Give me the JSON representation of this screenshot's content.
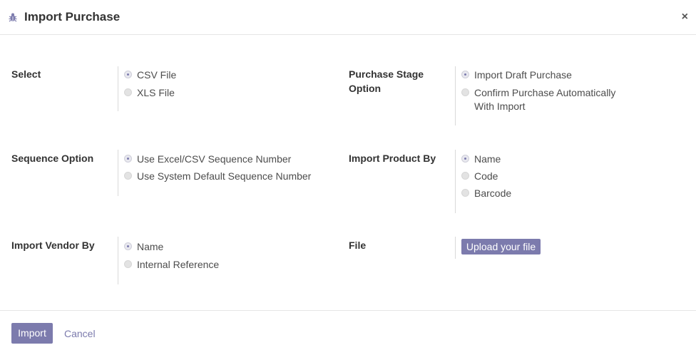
{
  "dialog": {
    "title": "Import Purchase",
    "close_label": "×"
  },
  "fields": {
    "select": {
      "label": "Select",
      "options": [
        {
          "label": "CSV File",
          "checked": true
        },
        {
          "label": "XLS File",
          "checked": false
        }
      ]
    },
    "purchase_stage": {
      "label": "Purchase Stage Option",
      "options": [
        {
          "label": "Import Draft Purchase",
          "checked": true
        },
        {
          "label": "Confirm Purchase Automatically With Import",
          "checked": false
        }
      ]
    },
    "sequence": {
      "label": "Sequence Option",
      "options": [
        {
          "label": "Use Excel/CSV Sequence Number",
          "checked": true
        },
        {
          "label": "Use System Default Sequence Number",
          "checked": false
        }
      ]
    },
    "product_by": {
      "label": "Import Product By",
      "options": [
        {
          "label": "Name",
          "checked": true
        },
        {
          "label": "Code",
          "checked": false
        },
        {
          "label": "Barcode",
          "checked": false
        }
      ]
    },
    "vendor_by": {
      "label": "Import Vendor By",
      "options": [
        {
          "label": "Name",
          "checked": true
        },
        {
          "label": "Internal Reference",
          "checked": false
        }
      ]
    },
    "file": {
      "label": "File",
      "upload_label": "Upload your file"
    }
  },
  "footer": {
    "import_label": "Import",
    "cancel_label": "Cancel"
  },
  "colors": {
    "accent": "#7c7bad"
  }
}
